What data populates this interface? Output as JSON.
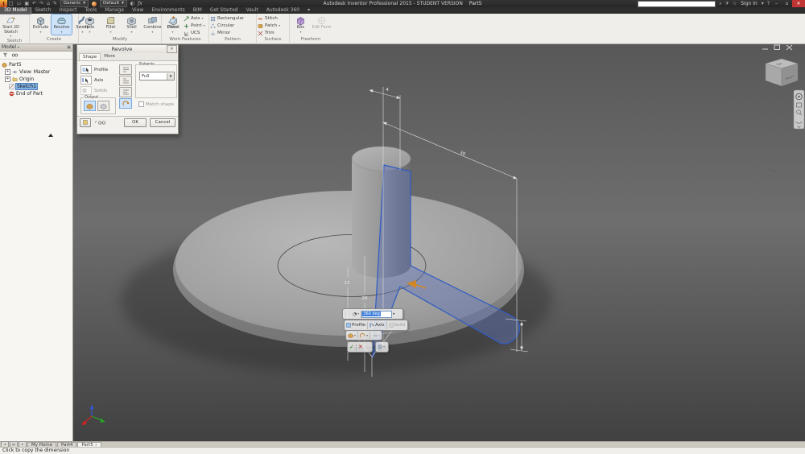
{
  "title_bar": {
    "title": "Autodesk Inventor Professional 2015 - STUDENT VERSION",
    "document": "Part5",
    "material_combo": "Generic",
    "appearance_combo": "Default",
    "sign_in": "Sign In"
  },
  "ribbon": {
    "tabs": [
      "3D Model",
      "Sketch",
      "Inspect",
      "Tools",
      "Manage",
      "View",
      "Environments",
      "BIM",
      "Get Started",
      "Vault",
      "Autodesk 360"
    ],
    "active_tab": "3D Model",
    "panels": {
      "sketch": {
        "label": "Sketch",
        "start_sketch": "Start 2D Sketch"
      },
      "create": {
        "label": "Create",
        "buttons": [
          "Extrude",
          "Revolve",
          "Sweep"
        ]
      },
      "modify": {
        "label": "Modify",
        "buttons": [
          "Hole",
          "Fillet",
          "Shell",
          "Combine",
          "Direct"
        ]
      },
      "work_features": {
        "label": "Work Features",
        "plane": "Plane",
        "items": [
          "Axis",
          "Point",
          "UCS"
        ]
      },
      "pattern": {
        "label": "Pattern",
        "items": [
          "Rectangular",
          "Circular",
          "Mirror"
        ]
      },
      "surface": {
        "label": "Surface",
        "items": [
          "Stitch",
          "Patch",
          "Trim"
        ]
      },
      "freeform": {
        "label": "Freeform",
        "buttons": [
          "Box",
          "Edit Form"
        ]
      }
    }
  },
  "browser": {
    "header": "Model",
    "tree": [
      "Part5",
      "View: Master",
      "Origin",
      "Sketch1",
      "End of Part"
    ]
  },
  "revolve_dialog": {
    "title": "Revolve",
    "tabs": [
      "Shape",
      "More"
    ],
    "selectors": [
      "Profile",
      "Axis",
      "Solids"
    ],
    "output_label": "Output",
    "extents_label": "Extents",
    "extents_value": "Full",
    "match_shape": "Match shape",
    "ok": "OK",
    "cancel": "Cancel"
  },
  "mini_toolbar": {
    "angle_value": "360 deg",
    "profile": "Profile",
    "axis": "Axis",
    "solid": "Solid"
  },
  "viewport": {
    "dimensions": {
      "d4": "4",
      "d30": "30",
      "d13": "13",
      "d28": "28"
    },
    "viewcube": {
      "top": "TOP",
      "front": "FRONT",
      "right": "RIGHT"
    }
  },
  "tab_bar": {
    "tabs": [
      "My Home",
      "Part4",
      "Part5"
    ],
    "active": "Part5"
  },
  "status_bar": {
    "message": "Click to copy the dimension"
  }
}
